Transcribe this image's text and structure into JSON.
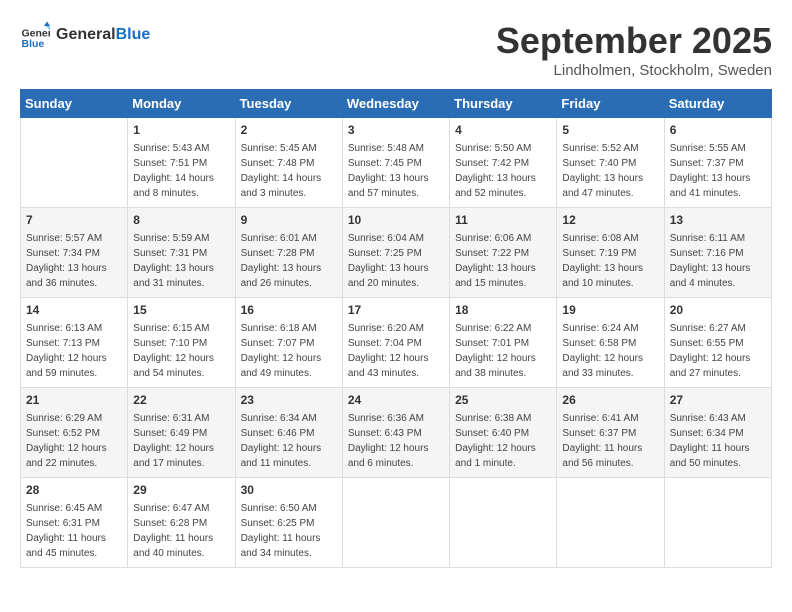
{
  "logo": {
    "line1": "General",
    "line2": "Blue"
  },
  "title": "September 2025",
  "location": "Lindholmen, Stockholm, Sweden",
  "headers": [
    "Sunday",
    "Monday",
    "Tuesday",
    "Wednesday",
    "Thursday",
    "Friday",
    "Saturday"
  ],
  "weeks": [
    [
      {
        "day": "",
        "info": ""
      },
      {
        "day": "1",
        "info": "Sunrise: 5:43 AM\nSunset: 7:51 PM\nDaylight: 14 hours\nand 8 minutes."
      },
      {
        "day": "2",
        "info": "Sunrise: 5:45 AM\nSunset: 7:48 PM\nDaylight: 14 hours\nand 3 minutes."
      },
      {
        "day": "3",
        "info": "Sunrise: 5:48 AM\nSunset: 7:45 PM\nDaylight: 13 hours\nand 57 minutes."
      },
      {
        "day": "4",
        "info": "Sunrise: 5:50 AM\nSunset: 7:42 PM\nDaylight: 13 hours\nand 52 minutes."
      },
      {
        "day": "5",
        "info": "Sunrise: 5:52 AM\nSunset: 7:40 PM\nDaylight: 13 hours\nand 47 minutes."
      },
      {
        "day": "6",
        "info": "Sunrise: 5:55 AM\nSunset: 7:37 PM\nDaylight: 13 hours\nand 41 minutes."
      }
    ],
    [
      {
        "day": "7",
        "info": "Sunrise: 5:57 AM\nSunset: 7:34 PM\nDaylight: 13 hours\nand 36 minutes."
      },
      {
        "day": "8",
        "info": "Sunrise: 5:59 AM\nSunset: 7:31 PM\nDaylight: 13 hours\nand 31 minutes."
      },
      {
        "day": "9",
        "info": "Sunrise: 6:01 AM\nSunset: 7:28 PM\nDaylight: 13 hours\nand 26 minutes."
      },
      {
        "day": "10",
        "info": "Sunrise: 6:04 AM\nSunset: 7:25 PM\nDaylight: 13 hours\nand 20 minutes."
      },
      {
        "day": "11",
        "info": "Sunrise: 6:06 AM\nSunset: 7:22 PM\nDaylight: 13 hours\nand 15 minutes."
      },
      {
        "day": "12",
        "info": "Sunrise: 6:08 AM\nSunset: 7:19 PM\nDaylight: 13 hours\nand 10 minutes."
      },
      {
        "day": "13",
        "info": "Sunrise: 6:11 AM\nSunset: 7:16 PM\nDaylight: 13 hours\nand 4 minutes."
      }
    ],
    [
      {
        "day": "14",
        "info": "Sunrise: 6:13 AM\nSunset: 7:13 PM\nDaylight: 12 hours\nand 59 minutes."
      },
      {
        "day": "15",
        "info": "Sunrise: 6:15 AM\nSunset: 7:10 PM\nDaylight: 12 hours\nand 54 minutes."
      },
      {
        "day": "16",
        "info": "Sunrise: 6:18 AM\nSunset: 7:07 PM\nDaylight: 12 hours\nand 49 minutes."
      },
      {
        "day": "17",
        "info": "Sunrise: 6:20 AM\nSunset: 7:04 PM\nDaylight: 12 hours\nand 43 minutes."
      },
      {
        "day": "18",
        "info": "Sunrise: 6:22 AM\nSunset: 7:01 PM\nDaylight: 12 hours\nand 38 minutes."
      },
      {
        "day": "19",
        "info": "Sunrise: 6:24 AM\nSunset: 6:58 PM\nDaylight: 12 hours\nand 33 minutes."
      },
      {
        "day": "20",
        "info": "Sunrise: 6:27 AM\nSunset: 6:55 PM\nDaylight: 12 hours\nand 27 minutes."
      }
    ],
    [
      {
        "day": "21",
        "info": "Sunrise: 6:29 AM\nSunset: 6:52 PM\nDaylight: 12 hours\nand 22 minutes."
      },
      {
        "day": "22",
        "info": "Sunrise: 6:31 AM\nSunset: 6:49 PM\nDaylight: 12 hours\nand 17 minutes."
      },
      {
        "day": "23",
        "info": "Sunrise: 6:34 AM\nSunset: 6:46 PM\nDaylight: 12 hours\nand 11 minutes."
      },
      {
        "day": "24",
        "info": "Sunrise: 6:36 AM\nSunset: 6:43 PM\nDaylight: 12 hours\nand 6 minutes."
      },
      {
        "day": "25",
        "info": "Sunrise: 6:38 AM\nSunset: 6:40 PM\nDaylight: 12 hours\nand 1 minute."
      },
      {
        "day": "26",
        "info": "Sunrise: 6:41 AM\nSunset: 6:37 PM\nDaylight: 11 hours\nand 56 minutes."
      },
      {
        "day": "27",
        "info": "Sunrise: 6:43 AM\nSunset: 6:34 PM\nDaylight: 11 hours\nand 50 minutes."
      }
    ],
    [
      {
        "day": "28",
        "info": "Sunrise: 6:45 AM\nSunset: 6:31 PM\nDaylight: 11 hours\nand 45 minutes."
      },
      {
        "day": "29",
        "info": "Sunrise: 6:47 AM\nSunset: 6:28 PM\nDaylight: 11 hours\nand 40 minutes."
      },
      {
        "day": "30",
        "info": "Sunrise: 6:50 AM\nSunset: 6:25 PM\nDaylight: 11 hours\nand 34 minutes."
      },
      {
        "day": "",
        "info": ""
      },
      {
        "day": "",
        "info": ""
      },
      {
        "day": "",
        "info": ""
      },
      {
        "day": "",
        "info": ""
      }
    ]
  ]
}
